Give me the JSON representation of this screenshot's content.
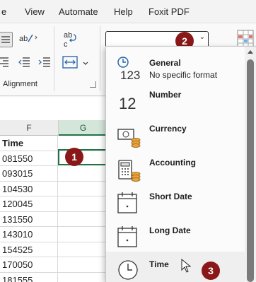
{
  "menu": [
    "e",
    "View",
    "Automate",
    "Help",
    "Foxit PDF"
  ],
  "ribbon": {
    "alignment_group": "Alignment",
    "ab_glyph": "ab",
    "c_glyph": "c",
    "number_format_value": ""
  },
  "sheet": {
    "columns": [
      "F",
      "G"
    ],
    "cells": [
      "Time",
      "081550",
      "093015",
      "104530",
      "120045",
      "131550",
      "143010",
      "154525",
      "170050",
      "181555"
    ]
  },
  "dropdown": {
    "options": [
      {
        "title": "General",
        "subtitle": "No specific format",
        "icon": "general-123-icon"
      },
      {
        "title": "Number",
        "subtitle": "",
        "icon": "number-12-icon"
      },
      {
        "title": "Currency",
        "subtitle": "",
        "icon": "currency-icon"
      },
      {
        "title": "Accounting",
        "subtitle": "",
        "icon": "accounting-icon"
      },
      {
        "title": "Short Date",
        "subtitle": "",
        "icon": "calendar-icon"
      },
      {
        "title": "Long Date",
        "subtitle": "",
        "icon": "calendar-icon"
      },
      {
        "title": "Time",
        "subtitle": "",
        "icon": "clock-icon"
      }
    ],
    "hovered": "Time"
  },
  "badges": [
    "1",
    "2",
    "3"
  ],
  "colors": {
    "badge": "#8b1818",
    "excel_green": "#217346",
    "coin": "#e8a33d",
    "border_blue": "#1f5fa8"
  }
}
